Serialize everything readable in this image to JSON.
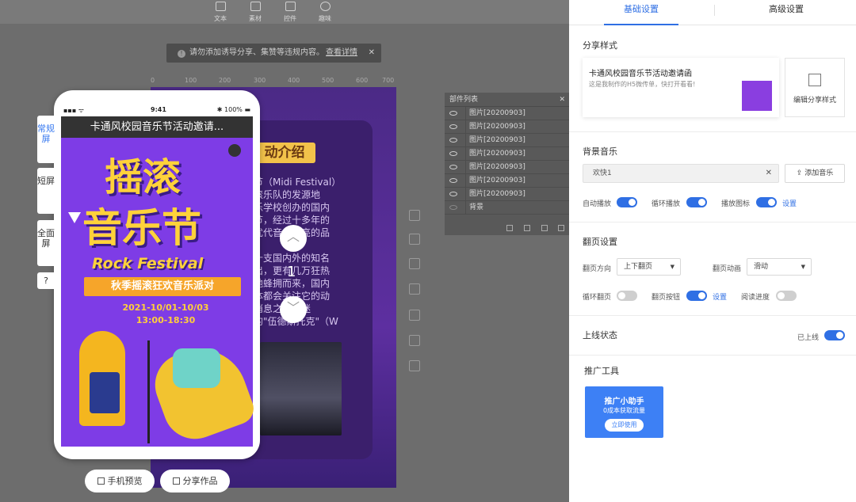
{
  "toolbar": {
    "items": [
      {
        "label": "文本",
        "icon": "text-icon"
      },
      {
        "label": "素材",
        "icon": "image-icon"
      },
      {
        "label": "控件",
        "icon": "widget-icon"
      },
      {
        "label": "趣味",
        "icon": "bulb-icon"
      }
    ]
  },
  "notice": {
    "text": "请勿添加诱导分享、集赞等违规内容。",
    "link": "查看详情",
    "close": "✕"
  },
  "ruler": {
    "ticks": [
      "0",
      "100",
      "200",
      "300",
      "400",
      "500",
      "600",
      "700"
    ]
  },
  "layers": {
    "title": "部件列表",
    "close": "✕",
    "items": [
      "图片[20200903]",
      "图片[20200903]",
      "图片[20200903]",
      "图片[20200903]",
      "图片[20200903]",
      "图片[20200903]",
      "图片[20200903]",
      "背景"
    ]
  },
  "poster_card": {
    "heading": "动介绍",
    "body": "节（Midi Festival）\n滚乐队的发源地\n乐学校创办的国内\n节，经过十多年的\n优代音乐喷亮的品\n\n十支国内外的知名\n出，更有几万狂热\n地蜂拥而来，国内\n体都会关注它的动\n消息之想，迷\n的\"伍德斯托克\"（W"
  },
  "phone": {
    "time": "9:41",
    "signal": "▪▪▪ ᯤ",
    "battery": "✱ 100% ▬",
    "title": "卡通风校园音乐节活动邀请...",
    "art_line1": "摇滚",
    "art_line2": "音乐节",
    "rock": "Rock Festival",
    "ribbon": "秋季摇滚狂欢音乐派对",
    "date1": "2021-10/01-10/03",
    "date2": "13:00-18:30"
  },
  "nav": {
    "page": "1",
    "up": "︿",
    "down": "﹀"
  },
  "left_tabs": [
    {
      "label": "常规屏",
      "active": true
    },
    {
      "label": "短屏",
      "active": false
    },
    {
      "label": "全面屏",
      "active": false
    },
    {
      "label": "?",
      "active": false
    }
  ],
  "bottom": {
    "preview": "手机预览",
    "share": "分享作品"
  },
  "panel": {
    "tabs": [
      "基础设置",
      "高级设置"
    ],
    "share": {
      "heading": "分享样式",
      "title": "卡通风校园音乐节活动邀请函",
      "desc": "这是我制作的H5微传单，快打开看看!",
      "edit": "编辑分享样式"
    },
    "music": {
      "heading": "背景音乐",
      "value": "欢快1",
      "clear": "✕",
      "add": "添加音乐",
      "autoplay": "自动播放",
      "loop": "循环播放",
      "icon": "播放图标",
      "setting": "设置"
    },
    "paging": {
      "heading": "翻页设置",
      "direction_label": "翻页方向",
      "direction_value": "上下翻页",
      "anim_label": "翻页动画",
      "anim_value": "滑动",
      "loop": "循环翻页",
      "button": "翻页按钮",
      "setting": "设置",
      "progress": "阅读进度"
    },
    "online": {
      "heading": "上线状态",
      "status": "已上线"
    },
    "promo": {
      "heading": "推广工具",
      "title": "推广小助手",
      "sub": "0成本获取流量",
      "btn": "立即使用"
    }
  },
  "toggles": {
    "autoplay": true,
    "loop_play": true,
    "play_icon": true,
    "loop_page": false,
    "page_button": true,
    "progress": false,
    "online": true
  },
  "colors": {
    "accent": "#2f6fe4",
    "poster": "#7e3ce6",
    "gold": "#ffd23a"
  }
}
